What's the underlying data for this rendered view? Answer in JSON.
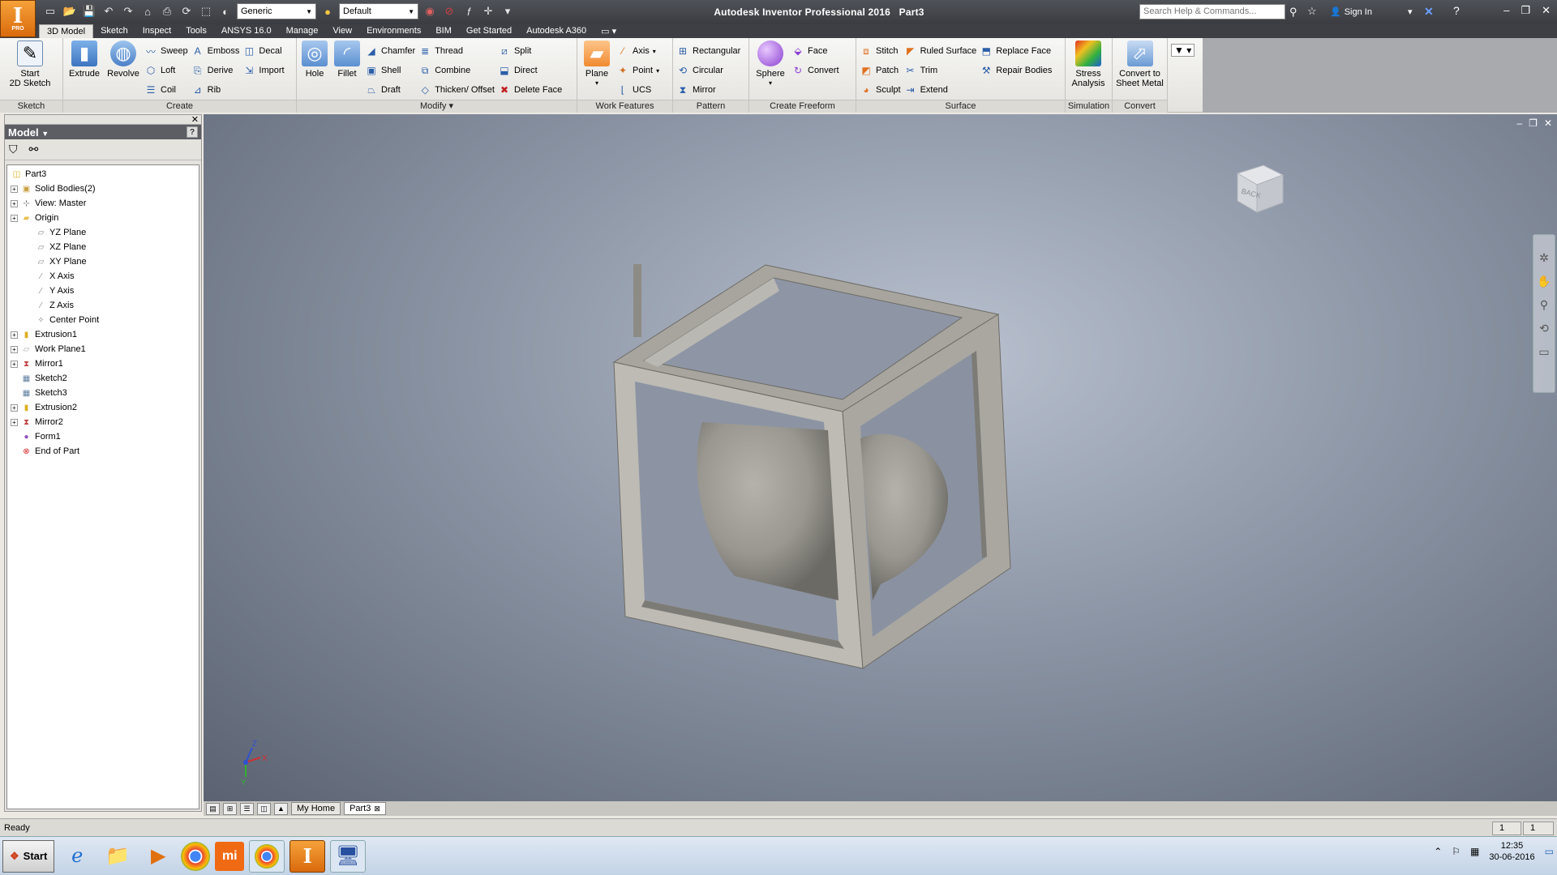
{
  "app": {
    "title": "Autodesk Inventor Professional 2016",
    "document": "Part3",
    "logo_letter": "I",
    "logo_sub": "PRO"
  },
  "qat": {
    "appearance": "Generic",
    "material": "Default"
  },
  "search": {
    "placeholder": "Search Help & Commands..."
  },
  "signin": "Sign In",
  "tabs": [
    "3D Model",
    "Sketch",
    "Inspect",
    "Tools",
    "ANSYS 16.0",
    "Manage",
    "View",
    "Environments",
    "BIM",
    "Get Started",
    "Autodesk A360"
  ],
  "ribbon": {
    "sketch": {
      "title": "Sketch",
      "start": "Start",
      "start2": "2D Sketch"
    },
    "create": {
      "title": "Create",
      "extrude": "Extrude",
      "revolve": "Revolve",
      "sweep": "Sweep",
      "loft": "Loft",
      "coil": "Coil",
      "emboss": "Emboss",
      "derive": "Derive",
      "rib": "Rib",
      "decal": "Decal",
      "import": "Import"
    },
    "modify": {
      "title": "Modify",
      "hole": "Hole",
      "fillet": "Fillet",
      "chamfer": "Chamfer",
      "shell": "Shell",
      "draft": "Draft",
      "thread": "Thread",
      "combine": "Combine",
      "thicken": "Thicken/ Offset",
      "split": "Split",
      "direct": "Direct",
      "delete_face": "Delete Face"
    },
    "work": {
      "title": "Work Features",
      "plane": "Plane",
      "axis": "Axis",
      "point": "Point",
      "ucs": "UCS"
    },
    "pattern": {
      "title": "Pattern",
      "rectangular": "Rectangular",
      "circular": "Circular",
      "mirror": "Mirror"
    },
    "freeform": {
      "title": "Create Freeform",
      "sphere": "Sphere",
      "face": "Face",
      "convert": "Convert"
    },
    "surface": {
      "title": "Surface",
      "stitch": "Stitch",
      "patch": "Patch",
      "sculpt": "Sculpt",
      "ruled": "Ruled Surface",
      "trim": "Trim",
      "extend": "Extend",
      "replace": "Replace Face",
      "repair": "Repair Bodies"
    },
    "simulation": {
      "title": "Simulation",
      "stress": "Stress",
      "stress2": "Analysis"
    },
    "convert": {
      "title": "Convert",
      "to": "Convert to",
      "to2": "Sheet Metal"
    }
  },
  "browser": {
    "title": "Model",
    "help": "?",
    "tree": [
      {
        "label": "Part3",
        "level": 0,
        "exp": false,
        "icon": "part-icon",
        "color": "#e0b020"
      },
      {
        "label": "Solid Bodies(2)",
        "level": 1,
        "exp": true,
        "icon": "solid-bodies-icon",
        "color": "#c8a040"
      },
      {
        "label": "View: Master",
        "level": 1,
        "exp": true,
        "icon": "view-icon",
        "color": "#555555"
      },
      {
        "label": "Origin",
        "level": 1,
        "exp": true,
        "icon": "folder-icon",
        "color": "#e8c050"
      },
      {
        "label": "YZ Plane",
        "level": 2,
        "exp": false,
        "icon": "plane-icon",
        "color": "#888888"
      },
      {
        "label": "XZ Plane",
        "level": 2,
        "exp": false,
        "icon": "plane-icon",
        "color": "#888888"
      },
      {
        "label": "XY Plane",
        "level": 2,
        "exp": false,
        "icon": "plane-icon",
        "color": "#888888"
      },
      {
        "label": "X Axis",
        "level": 2,
        "exp": false,
        "icon": "axis-icon",
        "color": "#888888"
      },
      {
        "label": "Y Axis",
        "level": 2,
        "exp": false,
        "icon": "axis-icon",
        "color": "#888888"
      },
      {
        "label": "Z Axis",
        "level": 2,
        "exp": false,
        "icon": "axis-icon",
        "color": "#888888"
      },
      {
        "label": "Center Point",
        "level": 2,
        "exp": false,
        "icon": "point-icon",
        "color": "#888888"
      },
      {
        "label": "Extrusion1",
        "level": 1,
        "exp": true,
        "icon": "extrusion-icon",
        "color": "#e0b020"
      },
      {
        "label": "Work Plane1",
        "level": 1,
        "exp": true,
        "icon": "work-plane-icon",
        "color": "#aaaaaa"
      },
      {
        "label": "Mirror1",
        "level": 1,
        "exp": true,
        "icon": "mirror-icon",
        "color": "#c04040"
      },
      {
        "label": "Sketch2",
        "level": 1,
        "exp": false,
        "icon": "sketch-icon",
        "color": "#6080a0"
      },
      {
        "label": "Sketch3",
        "level": 1,
        "exp": false,
        "icon": "sketch-icon",
        "color": "#6080a0"
      },
      {
        "label": "Extrusion2",
        "level": 1,
        "exp": true,
        "icon": "extrusion-icon",
        "color": "#e0b020"
      },
      {
        "label": "Mirror2",
        "level": 1,
        "exp": true,
        "icon": "mirror-icon",
        "color": "#c04040"
      },
      {
        "label": "Form1",
        "level": 1,
        "exp": false,
        "icon": "form-icon",
        "color": "#9050c0"
      },
      {
        "label": "End of Part",
        "level": 1,
        "exp": false,
        "icon": "end-of-part-icon",
        "color": "#d02020"
      }
    ]
  },
  "viewcube": {
    "face": "BACK"
  },
  "triad": {
    "x": "X",
    "y": "Y",
    "z": "Z"
  },
  "doc_tabs": {
    "home": "My Home",
    "part": "Part3"
  },
  "status": {
    "text": "Ready",
    "count1": "1",
    "count2": "1"
  },
  "taskbar": {
    "start": "Start",
    "time": "12:35",
    "date": "30-06-2016"
  }
}
